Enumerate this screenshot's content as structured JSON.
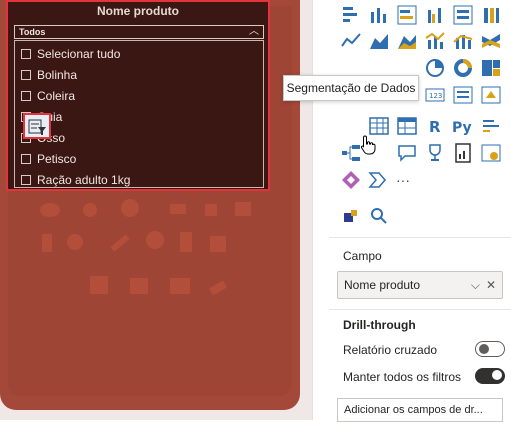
{
  "slicer": {
    "title": "Nome produto",
    "dropdown_value": "Todos",
    "items": [
      {
        "label": "Selecionar tudo",
        "checked": false
      },
      {
        "label": "Bolinha",
        "checked": false
      },
      {
        "label": "Coleira",
        "checked": false
      },
      {
        "label": "Guia",
        "checked": false
      },
      {
        "label": "Osso",
        "checked": false
      },
      {
        "label": "Petisco",
        "checked": false
      },
      {
        "label": "Ração adulto 1kg",
        "checked": false
      }
    ]
  },
  "viz_panel": {
    "tooltip": "Segmentação de Dados",
    "more_label": "···",
    "highlighted_visual": "slicer-visual-icon"
  },
  "fields_pane": {
    "campo_label": "Campo",
    "campo_value": "Nome produto",
    "drill_title": "Drill-through",
    "cross_report_label": "Relatório cruzado",
    "cross_report_on": false,
    "keep_filters_label": "Manter todos os filtros",
    "keep_filters_on": true,
    "add_drill_placeholder": "Adicionar os campos de dr..."
  },
  "colors": {
    "report_bg": "#a4493a",
    "slicer_bg": "#3a1712",
    "highlight_border": "#e2353b",
    "viz_blue": "#2f6fb0",
    "viz_yellow": "#d9a21b"
  }
}
